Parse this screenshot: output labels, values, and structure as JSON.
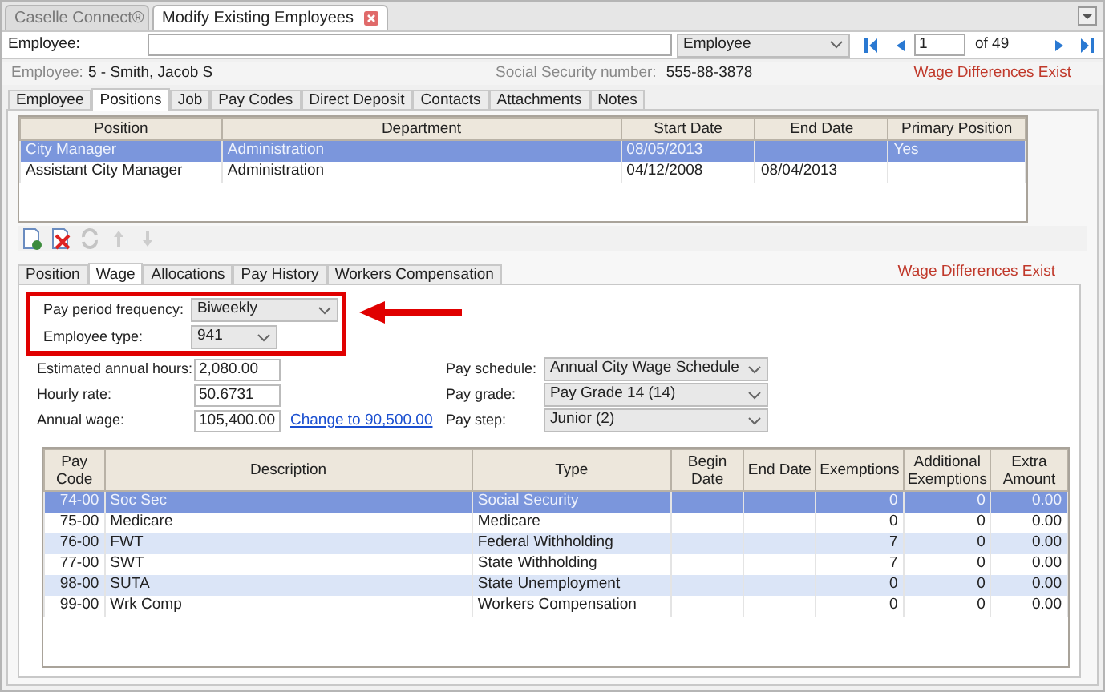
{
  "window_tabs": [
    {
      "label": "Caselle Connect®",
      "selected": false,
      "closable": false
    },
    {
      "label": "Modify Existing Employees",
      "selected": true,
      "closable": true
    }
  ],
  "lookup": {
    "label": "Employee:",
    "type_select": "Employee",
    "page": "1",
    "page_count": "of 49"
  },
  "employee_info": {
    "label": "Employee:",
    "name": "5 - Smith, Jacob S",
    "ssn_label": "Social Security number:",
    "ssn": "555-88-3878",
    "warning": "Wage Differences Exist"
  },
  "main_tabs": [
    {
      "label": "Employee",
      "selected": false
    },
    {
      "label": "Positions",
      "selected": true
    },
    {
      "label": "Job",
      "selected": false
    },
    {
      "label": "Pay Codes",
      "selected": false
    },
    {
      "label": "Direct Deposit",
      "selected": false
    },
    {
      "label": "Contacts",
      "selected": false
    },
    {
      "label": "Attachments",
      "selected": false
    },
    {
      "label": "Notes",
      "selected": false
    }
  ],
  "positions_table": {
    "columns": [
      "Position",
      "Department",
      "Start Date",
      "End Date",
      "Primary Position"
    ],
    "rows": [
      {
        "cells": [
          "City Manager",
          "Administration",
          "08/05/2013",
          null,
          "Yes"
        ],
        "selected": true
      },
      {
        "cells": [
          "Assistant City Manager",
          "Administration",
          "04/12/2008",
          "08/04/2013",
          null
        ],
        "selected": false
      }
    ]
  },
  "toolbar": [
    {
      "kind": "new",
      "disabled": false
    },
    {
      "kind": "delete",
      "disabled": false
    },
    {
      "kind": "refresh",
      "disabled": true
    },
    {
      "kind": "up",
      "disabled": true
    },
    {
      "kind": "down",
      "disabled": true
    }
  ],
  "sub_tabs": [
    {
      "label": "Position",
      "selected": false
    },
    {
      "label": "Wage",
      "selected": true
    },
    {
      "label": "Allocations",
      "selected": false
    },
    {
      "label": "Pay History",
      "selected": false
    },
    {
      "label": "Workers Compensation",
      "selected": false
    }
  ],
  "sub_warning": "Wage Differences Exist",
  "wage": {
    "highlighted_fields": [
      {
        "label": "Pay period frequency:",
        "value": "Biweekly"
      },
      {
        "label": "Employee type:",
        "value": "941"
      }
    ],
    "left_fields": [
      {
        "label": "Estimated annual hours:",
        "value": "2,080.00"
      },
      {
        "label": "Hourly rate:",
        "value": "50.6731"
      },
      {
        "label": "Annual wage:",
        "value": "105,400.00",
        "link": "Change to 90,500.00"
      }
    ],
    "right_fields": [
      {
        "label": "Pay schedule:",
        "value": "Annual City Wage Schedule"
      },
      {
        "label": "Pay grade:",
        "value": "Pay Grade 14 (14)"
      },
      {
        "label": "Pay step:",
        "value": "Junior (2)"
      }
    ]
  },
  "pay_codes_table": {
    "columns": [
      "Pay Code",
      "Description",
      "Type",
      "Begin Date",
      "End Date",
      "Exemptions",
      "Additional Exemptions",
      "Extra Amount"
    ],
    "rows": [
      {
        "cells": [
          "74-00",
          "Soc Sec",
          "Social Security",
          null,
          null,
          "0",
          "0",
          "0.00"
        ],
        "selected": true
      },
      {
        "cells": [
          "75-00",
          "Medicare",
          "Medicare",
          null,
          null,
          "0",
          "0",
          "0.00"
        ],
        "selected": false
      },
      {
        "cells": [
          "76-00",
          "FWT",
          "Federal Withholding",
          null,
          null,
          "7",
          "0",
          "0.00"
        ],
        "selected": false
      },
      {
        "cells": [
          "77-00",
          "SWT",
          "State Withholding",
          null,
          null,
          "7",
          "0",
          "0.00"
        ],
        "selected": false
      },
      {
        "cells": [
          "98-00",
          "SUTA",
          "State Unemployment",
          null,
          null,
          "0",
          "0",
          "0.00"
        ],
        "selected": false
      },
      {
        "cells": [
          "99-00",
          "Wrk Comp",
          "Workers Compensation",
          null,
          null,
          "0",
          "0",
          "0.00"
        ],
        "selected": false
      }
    ]
  }
}
